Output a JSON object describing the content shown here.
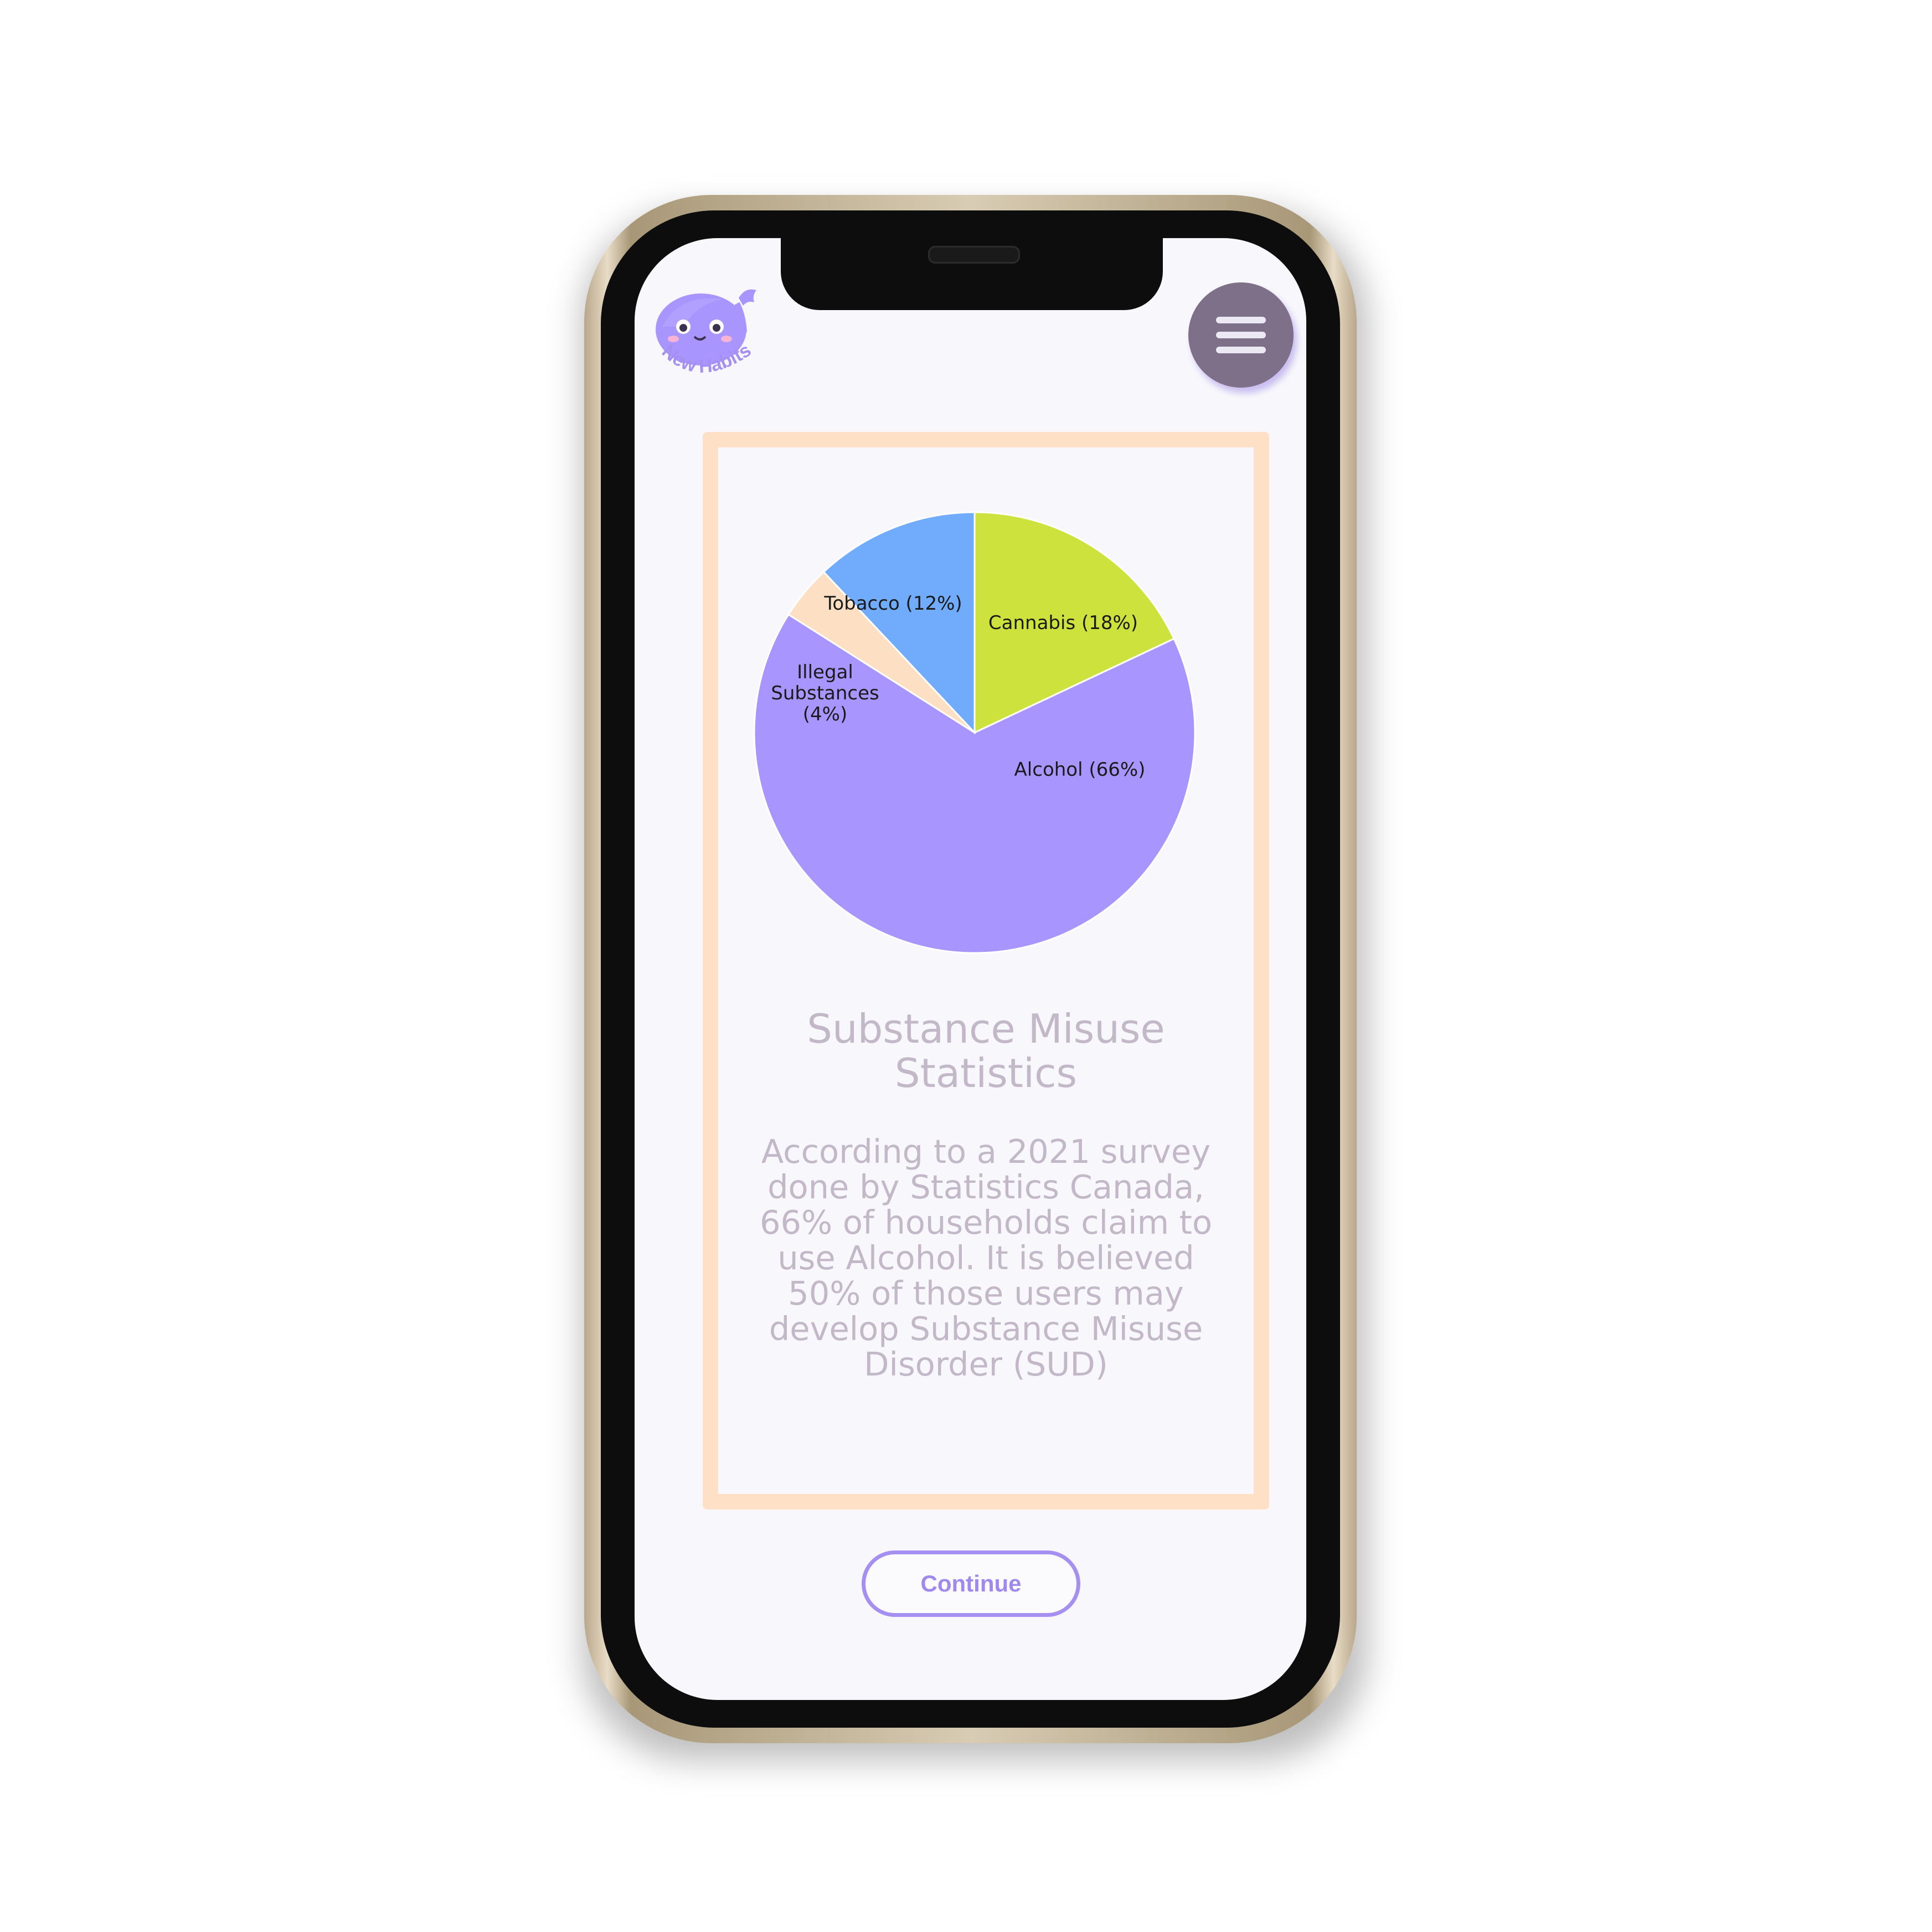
{
  "app": {
    "logo_text": "New Habits",
    "menu_icon": "hamburger-menu-icon"
  },
  "colors": {
    "accent": "#a58ff0",
    "card_border": "#fde0c6",
    "menu_button": "#7e7088",
    "text_muted": "#c2b8c8"
  },
  "card": {
    "title": "Substance Misuse Statistics",
    "body": "According to a 2021 survey done by Statistics Canada, 66% of households claim to use Alcohol. It is believed 50% of those users may develop Substance Misuse Disorder (SUD)"
  },
  "chart_data": {
    "type": "pie",
    "categories": [
      "Cannabis (18%)",
      "Alcohol (66%)",
      "Illegal Substances (4%)",
      "Tobacco (12%)"
    ],
    "values": [
      18,
      66,
      4,
      12
    ],
    "colors": [
      "#cde23c",
      "#a895fd",
      "#fddfc4",
      "#70acfb"
    ]
  },
  "actions": {
    "continue_label": "Continue"
  }
}
